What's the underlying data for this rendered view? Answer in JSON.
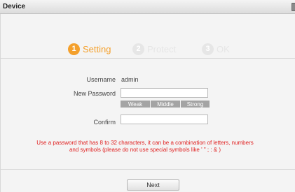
{
  "window": {
    "title": "Device"
  },
  "steps": [
    {
      "num": "1",
      "label": "Setting",
      "active": true
    },
    {
      "num": "2",
      "label": "Protect",
      "active": false
    },
    {
      "num": "3",
      "label": "OK",
      "active": false
    }
  ],
  "form": {
    "username_label": "Username",
    "username_value": "admin",
    "new_password_label": "New Password",
    "new_password_value": "",
    "strength": [
      "Weak",
      "Middle",
      "Strong"
    ],
    "confirm_label": "Confirm",
    "confirm_value": ""
  },
  "note": "Use a password that has 8 to 32 characters, it can be a combination of letters, numbers and symbols (please do not use special symbols like ' \" ; : & )",
  "buttons": {
    "next": "Next"
  },
  "colors": {
    "active_step": "#f4a02c",
    "inactive_step": "#e6e6e6",
    "note": "#e02020"
  }
}
